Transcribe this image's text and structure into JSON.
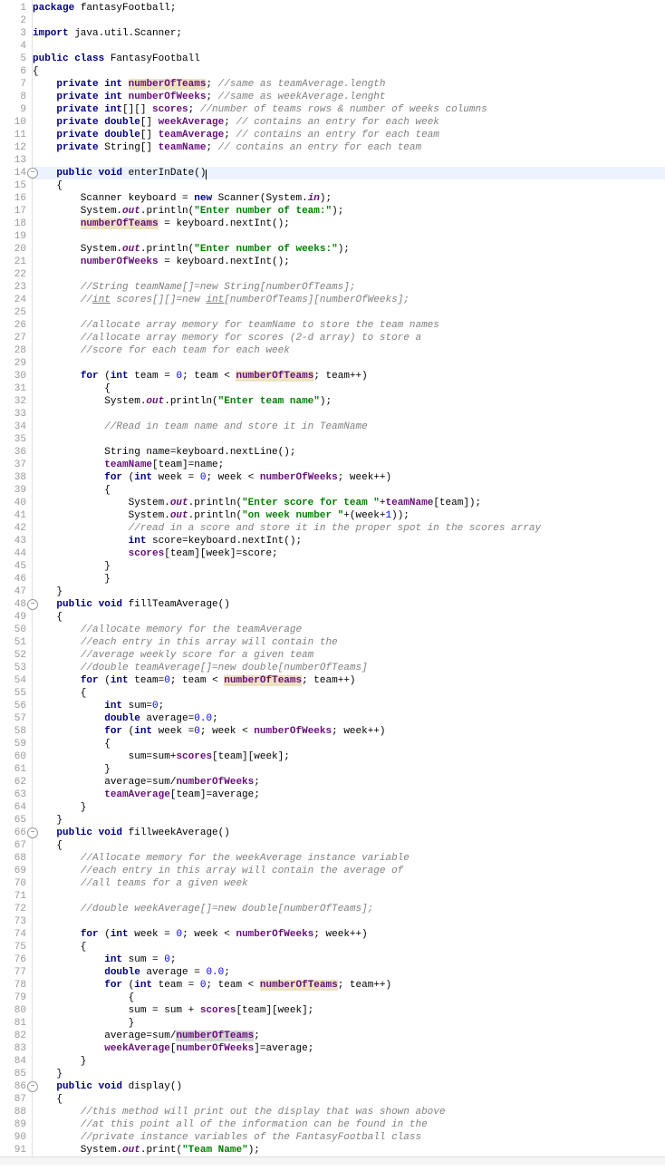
{
  "lines": [
    {
      "n": 1,
      "html": "<span class='kw'>package</span> fantasyFootball;"
    },
    {
      "n": 2,
      "html": ""
    },
    {
      "n": 3,
      "html": "<span class='kw'>import</span> java.util.Scanner;"
    },
    {
      "n": 4,
      "html": ""
    },
    {
      "n": 5,
      "html": "<span class='kw'>public class</span> FantasyFootball"
    },
    {
      "n": 6,
      "html": "{"
    },
    {
      "n": 7,
      "html": "    <span class='kw'>private int</span> <span class='fld hl'>numberOfTeams</span>; <span class='cm'>//same as teamAverage.length</span>"
    },
    {
      "n": 8,
      "html": "    <span class='kw'>private int</span> <span class='fld'>numberOfWeeks</span>; <span class='cm'>//same as weekAverage.lenght</span>"
    },
    {
      "n": 9,
      "html": "    <span class='kw'>private int</span>[][] <span class='fld'>scores</span>; <span class='cm'>//number of teams rows &amp; number of weeks columns</span>"
    },
    {
      "n": 10,
      "html": "    <span class='kw'>private double</span>[] <span class='fld'>weekAverage</span>; <span class='cm'>// contains an entry for each week</span>"
    },
    {
      "n": 11,
      "html": "    <span class='kw'>private double</span>[] <span class='fld'>teamAverage</span>; <span class='cm'>// contains an entry for each team</span>"
    },
    {
      "n": 12,
      "html": "    <span class='kw'>private</span> String[] <span class='fld'>teamName</span>; <span class='cm'>// contains an entry for each team</span>"
    },
    {
      "n": 13,
      "html": ""
    },
    {
      "n": 14,
      "fold": true,
      "current": true,
      "html": "    <span class='kw'>public void</span> enterInDate()<span class='caret'></span>"
    },
    {
      "n": 15,
      "html": "    {"
    },
    {
      "n": 16,
      "html": "        Scanner <span class='lv'>keyboard</span> = <span class='kw'>new</span> Scanner(System.<span class='sf'>in</span>);"
    },
    {
      "n": 17,
      "html": "        System.<span class='sf'>out</span>.println(<span class='st'>\"Enter number of team:\"</span>);"
    },
    {
      "n": 18,
      "html": "        <span class='fld hl'>numberOfTeams</span> = keyboard.nextInt();"
    },
    {
      "n": 19,
      "html": ""
    },
    {
      "n": 20,
      "html": "        System.<span class='sf'>out</span>.println(<span class='st'>\"Enter number of weeks:\"</span>);"
    },
    {
      "n": 21,
      "html": "        <span class='fld'>numberOfWeeks</span> = keyboard.nextInt();"
    },
    {
      "n": 22,
      "html": ""
    },
    {
      "n": 23,
      "html": "        <span class='cm'>//String teamName[]=new String[numberOfTeams];</span>"
    },
    {
      "n": 24,
      "html": "        <span class='cm'>//<u>int</u> scores[][]=new <u>int</u>[numberOfTeams][numberOfWeeks];</span>"
    },
    {
      "n": 25,
      "html": ""
    },
    {
      "n": 26,
      "html": "        <span class='cm'>//allocate array memory for teamName to store the team names</span>"
    },
    {
      "n": 27,
      "html": "        <span class='cm'>//allocate array memory for scores (2-d array) to store a</span>"
    },
    {
      "n": 28,
      "html": "        <span class='cm'>//score for each team for each week</span>"
    },
    {
      "n": 29,
      "html": ""
    },
    {
      "n": 30,
      "html": "        <span class='kw'>for</span> (<span class='kw'>int</span> team = <span class='nm'>0</span>; team &lt; <span class='fld hl'>numberOfTeams</span>; team++)"
    },
    {
      "n": 31,
      "html": "            {"
    },
    {
      "n": 32,
      "html": "            System.<span class='sf'>out</span>.println(<span class='st'>\"Enter team name\"</span>);"
    },
    {
      "n": 33,
      "html": ""
    },
    {
      "n": 34,
      "html": "            <span class='cm'>//Read in team name and store it in TeamName</span>"
    },
    {
      "n": 35,
      "html": ""
    },
    {
      "n": 36,
      "html": "            String name=keyboard.nextLine();"
    },
    {
      "n": 37,
      "html": "            <span class='fld'>teamName</span>[team]=name;"
    },
    {
      "n": 38,
      "html": "            <span class='kw'>for</span> (<span class='kw'>int</span> week = <span class='nm'>0</span>; week &lt; <span class='fld'>numberOfWeeks</span>; week++)"
    },
    {
      "n": 39,
      "html": "            {"
    },
    {
      "n": 40,
      "html": "                System.<span class='sf'>out</span>.println(<span class='st'>\"Enter score for team \"</span>+<span class='fld'>teamName</span>[team]);"
    },
    {
      "n": 41,
      "html": "                System.<span class='sf'>out</span>.println(<span class='st'>\"on week number \"</span>+(week+<span class='nm'>1</span>));"
    },
    {
      "n": 42,
      "html": "                <span class='cm'>//read in a score and store it in the proper spot in the scores array</span>"
    },
    {
      "n": 43,
      "html": "                <span class='kw'>int</span> score=keyboard.nextInt();"
    },
    {
      "n": 44,
      "html": "                <span class='fld'>scores</span>[team][week]=score;"
    },
    {
      "n": 45,
      "html": "            }"
    },
    {
      "n": 46,
      "html": "            }"
    },
    {
      "n": 47,
      "html": "    }"
    },
    {
      "n": 48,
      "fold": true,
      "html": "    <span class='kw'>public void</span> fillTeamAverage()"
    },
    {
      "n": 49,
      "html": "    {"
    },
    {
      "n": 50,
      "html": "        <span class='cm'>//allocate memory for the teamAverage</span>"
    },
    {
      "n": 51,
      "html": "        <span class='cm'>//each entry in this array will contain the</span>"
    },
    {
      "n": 52,
      "html": "        <span class='cm'>//average weekly score for a given team</span>"
    },
    {
      "n": 53,
      "html": "        <span class='cm'>//double teamAverage[]=new double[numberOfTeams]</span>"
    },
    {
      "n": 54,
      "html": "        <span class='kw'>for</span> (<span class='kw'>int</span> team=<span class='nm'>0</span>; team &lt; <span class='fld hl'>numberOfTeams</span>; team++)"
    },
    {
      "n": 55,
      "html": "        {"
    },
    {
      "n": 56,
      "html": "            <span class='kw'>int</span> sum=<span class='nm'>0</span>;"
    },
    {
      "n": 57,
      "html": "            <span class='kw'>double</span> average=<span class='nm'>0.0</span>;"
    },
    {
      "n": 58,
      "html": "            <span class='kw'>for</span> (<span class='kw'>int</span> week =<span class='nm'>0</span>; week &lt; <span class='fld'>numberOfWeeks</span>; week++)"
    },
    {
      "n": 59,
      "html": "            {"
    },
    {
      "n": 60,
      "html": "                sum=sum+<span class='fld'>scores</span>[team][week];"
    },
    {
      "n": 61,
      "html": "            }"
    },
    {
      "n": 62,
      "html": "            average=sum/<span class='fld'>numberOfWeeks</span>;"
    },
    {
      "n": 63,
      "html": "            <span class='fld'>teamAverage</span>[team]=average;"
    },
    {
      "n": 64,
      "html": "        }"
    },
    {
      "n": 65,
      "html": "    }"
    },
    {
      "n": 66,
      "fold": true,
      "html": "    <span class='kw'>public void</span> fillweekAverage()"
    },
    {
      "n": 67,
      "html": "    {"
    },
    {
      "n": 68,
      "html": "        <span class='cm'>//Allocate memory for the weekAverage instance variable</span>"
    },
    {
      "n": 69,
      "html": "        <span class='cm'>//each entry in this array will contain the average of</span>"
    },
    {
      "n": 70,
      "html": "        <span class='cm'>//all teams for a given week</span>"
    },
    {
      "n": 71,
      "html": ""
    },
    {
      "n": 72,
      "html": "        <span class='cm'>//double weekAverage[]=new double[numberOfTeams];</span>"
    },
    {
      "n": 73,
      "html": ""
    },
    {
      "n": 74,
      "html": "        <span class='kw'>for</span> (<span class='kw'>int</span> week = <span class='nm'>0</span>; week &lt; <span class='fld'>numberOfWeeks</span>; week++)"
    },
    {
      "n": 75,
      "html": "        {"
    },
    {
      "n": 76,
      "html": "            <span class='kw'>int</span> sum = <span class='nm'>0</span>;"
    },
    {
      "n": 77,
      "html": "            <span class='kw'>double</span> average = <span class='nm'>0.0</span>;"
    },
    {
      "n": 78,
      "html": "            <span class='kw'>for</span> (<span class='kw'>int</span> team = <span class='nm'>0</span>; team &lt; <span class='fld hl'>numberOfTeams</span>; team++)"
    },
    {
      "n": 79,
      "html": "                {"
    },
    {
      "n": 80,
      "html": "                sum = sum + <span class='fld'>scores</span>[team][week];"
    },
    {
      "n": 81,
      "html": "                }"
    },
    {
      "n": 82,
      "html": "            average=sum/<span class='fld hlg'>numberOfTeams</span>;"
    },
    {
      "n": 83,
      "html": "            <span class='fld'>weekAverage</span>[<span class='fld'>numberOfWeeks</span>]=average;"
    },
    {
      "n": 84,
      "html": "        }"
    },
    {
      "n": 85,
      "html": "    }"
    },
    {
      "n": 86,
      "fold": true,
      "html": "    <span class='kw'>public void</span> display()"
    },
    {
      "n": 87,
      "html": "    {"
    },
    {
      "n": 88,
      "html": "        <span class='cm'>//this method will print out the display that was shown above</span>"
    },
    {
      "n": 89,
      "html": "        <span class='cm'>//at this point all of the information can be found in the</span>"
    },
    {
      "n": 90,
      "html": "        <span class='cm'>//private instance variables of the FantasyFootball class</span>"
    },
    {
      "n": 91,
      "html": "        System.<span class='sf'>out</span>.print(<span class='st'>\"Team Name\"</span>);"
    }
  ]
}
